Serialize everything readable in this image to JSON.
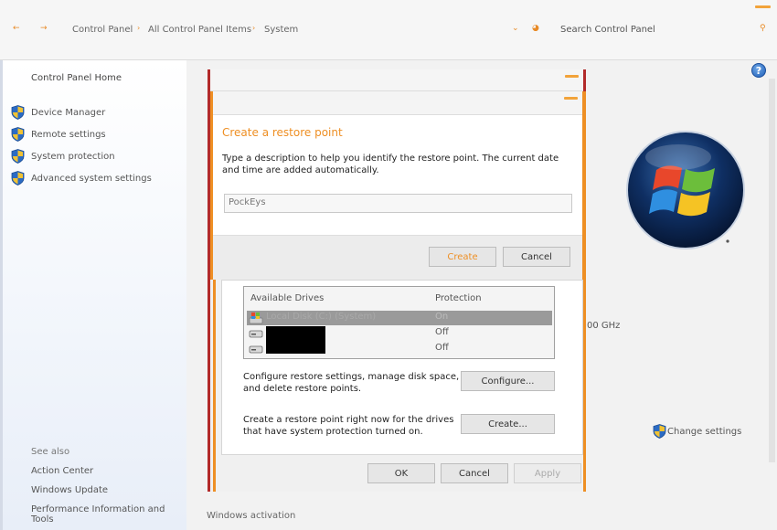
{
  "address_bar": {
    "breadcrumbs": [
      "Control Panel",
      "All Control Panel Items",
      "System"
    ],
    "search_placeholder": "Search Control Panel"
  },
  "left_pane": {
    "home_link": "Control Panel Home",
    "tasks": [
      {
        "label": "Device Manager",
        "icon": "uac-shield-icon"
      },
      {
        "label": "Remote settings",
        "icon": "uac-shield-icon"
      },
      {
        "label": "System protection",
        "icon": "uac-shield-icon"
      },
      {
        "label": "Advanced system settings",
        "icon": "uac-shield-icon"
      }
    ],
    "see_also_heading": "See also",
    "see_also_links": [
      "Action Center",
      "Windows Update",
      "Performance Information and Tools"
    ]
  },
  "main": {
    "processor_speed_fragment": "00 GHz",
    "change_settings": "Change settings",
    "windows_activation": "Windows activation"
  },
  "system_properties": {
    "drives_header": {
      "name": "Available Drives",
      "protection": "Protection"
    },
    "drives": [
      {
        "name": "Local Disk (C:) (System)",
        "protection": "On",
        "selected": true
      },
      {
        "name": "",
        "protection": "Off",
        "selected": false
      },
      {
        "name": "",
        "protection": "Off",
        "selected": false
      }
    ],
    "configure_text": "Configure restore settings, manage disk space, and delete restore points.",
    "configure_button": "Configure...",
    "create_text": "Create a restore point right now for the drives that have system protection turned on.",
    "create_button": "Create...",
    "ok_button": "OK",
    "cancel_button": "Cancel",
    "apply_button": "Apply"
  },
  "restore_dialog": {
    "heading": "Create a restore point",
    "description": "Type a description to help you identify the restore point. The current date and time are added automatically.",
    "input_value": "PockEys",
    "create_button": "Create",
    "cancel_button": "Cancel"
  },
  "colors": {
    "accent_orange": "#ee8f24",
    "frame_red": "#b22a2a"
  }
}
